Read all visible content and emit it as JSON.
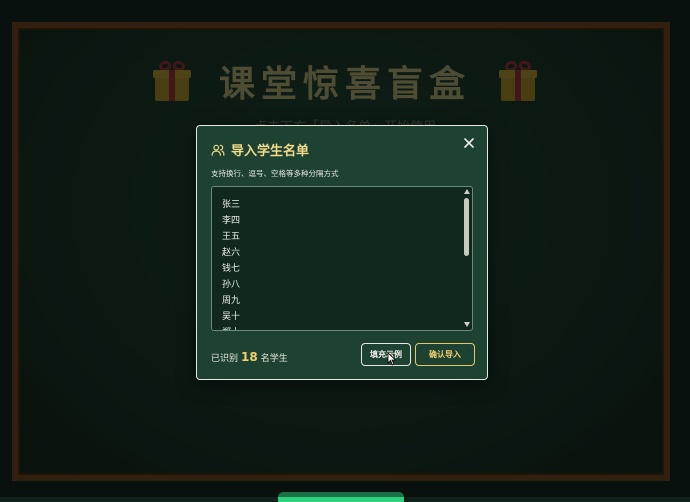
{
  "background": {
    "title": "课堂惊喜盲盒",
    "subtitle": "点击下方「导入名单」开始使用"
  },
  "modal": {
    "title": "导入学生名单",
    "hint": "支持换行、逗号、空格等多种分隔方式",
    "names": [
      "张三",
      "李四",
      "王五",
      "赵六",
      "钱七",
      "孙八",
      "周九",
      "吴十",
      "郑十"
    ],
    "count_prefix": "已识别",
    "count": "18",
    "count_suffix": "名学生",
    "example_button": "填充示例",
    "import_button": "确认导入"
  },
  "colors": {
    "accent": "#f3d98a",
    "board": "#1d3a2c",
    "frame": "#5a3a1c"
  }
}
